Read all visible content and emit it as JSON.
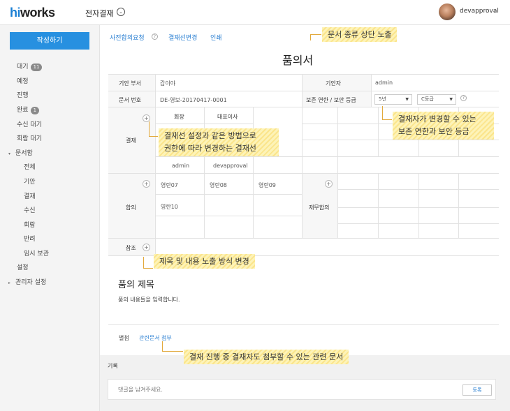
{
  "header": {
    "logo_hi": "hi",
    "logo_works": "works",
    "app_title": "전자결재",
    "app_menu_icon": "chevron-down-circle-icon",
    "user_name": "devapproval",
    "user_caret": "⌄"
  },
  "sidebar": {
    "write_button": "작성하기",
    "items": [
      {
        "label": "대기",
        "badge": "11"
      },
      {
        "label": "예정"
      },
      {
        "label": "진행"
      },
      {
        "label": "완료",
        "badge": "1"
      },
      {
        "label": "수신 대기"
      },
      {
        "label": "회람 대기"
      },
      {
        "label": "문서함",
        "caret": "▾"
      },
      {
        "label": "전체"
      },
      {
        "label": "기안"
      },
      {
        "label": "결재"
      },
      {
        "label": "수신"
      },
      {
        "label": "회람"
      },
      {
        "label": "반려"
      },
      {
        "label": "임시 보관"
      },
      {
        "label": "설정"
      },
      {
        "label": "관리자 설정",
        "caret": "▸"
      }
    ]
  },
  "actions": {
    "pre_agreement": "사전합의요청",
    "approval_line_change": "결재선변경",
    "print": "인쇄",
    "help_icon": "?"
  },
  "doc": {
    "title": "품의서",
    "fields": {
      "dept_label": "기안 부서",
      "dept_value": "갑이야",
      "drafter_label": "기안자",
      "drafter_value": "admin",
      "docno_label": "문서 번호",
      "docno_value": "DE-영보-20170417-0001",
      "retention_label": "보존 연한 / 보안 등급",
      "retention_value": "5년",
      "security_value": "C등급"
    },
    "approval": {
      "label": "결재",
      "roles": [
        "회장",
        "대표이사"
      ],
      "approvers": [
        "admin",
        "devapproval"
      ]
    },
    "agreement": {
      "label": "합의",
      "members": [
        "영란07",
        "영란08",
        "영란09",
        "영란10"
      ]
    },
    "finance_agreement": {
      "label": "재무합의"
    },
    "reference": {
      "label": "참조"
    },
    "subject": "품의 제목",
    "body": "품의 내용들을 입력합니다."
  },
  "attachments": {
    "label": "별첨",
    "link": "관련문서 첨부"
  },
  "comments": {
    "title": "기록",
    "placeholder": "댓글을 남겨주세요.",
    "submit": "등록"
  },
  "callouts": {
    "doc_type": "문서 종류 상단 노출",
    "approver_change_line1": "결재자가 변경할 수 있는",
    "approver_change_line2": "보존 연한과 보안 등급",
    "approval_line_line1": "결재선 설정과 같은 방법으로",
    "approval_line_line2": "권한에 따라 변경하는 결재선",
    "subject_display": "제목 및 내용 노출 방식 변경",
    "attach_related": "결재 진행 중 결재자도 첨부할 수 있는 관련 문서"
  },
  "colors": {
    "accent": "#2790e0",
    "link": "#2a7fd2",
    "callout": "#fbe58c"
  }
}
